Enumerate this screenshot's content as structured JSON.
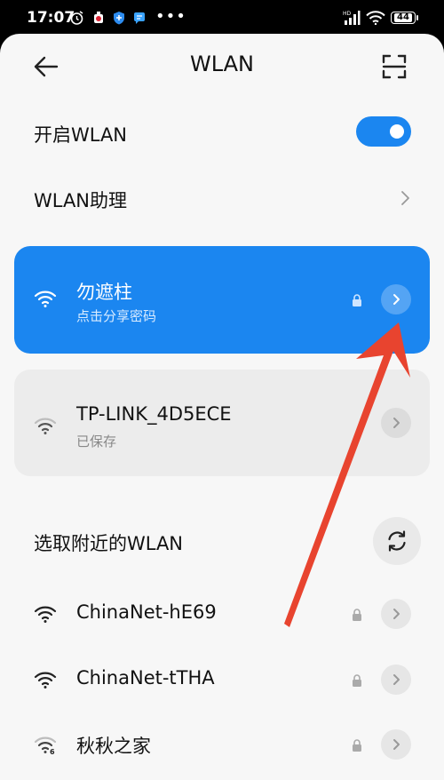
{
  "status_bar": {
    "time": "17:07",
    "more": "•••",
    "battery_level": "44",
    "icons": [
      "alarm-icon",
      "app-notification-icon",
      "shield-app-icon",
      "message-app-icon",
      "signal-icon",
      "wifi-icon",
      "battery-icon"
    ]
  },
  "header": {
    "title": "WLAN",
    "back_icon": "back-arrow-icon",
    "scan_icon": "scan-icon"
  },
  "settings": {
    "enable_wlan_label": "开启WLAN",
    "enable_wlan_on": true,
    "assistant_label": "WLAN助理"
  },
  "connected_network": {
    "name": "勿遮柱",
    "subtitle": "点击分享密码",
    "locked": true
  },
  "saved_network": {
    "name": "TP-LINK_4D5ECE",
    "subtitle": "已保存"
  },
  "nearby": {
    "section_title": "选取附近的WLAN",
    "refresh_icon": "refresh-icon",
    "networks": [
      {
        "name": "ChinaNet-hE69",
        "locked": true
      },
      {
        "name": "ChinaNet-tTHA",
        "locked": true
      },
      {
        "name": "秋秋之家",
        "locked": true,
        "wifi_badge": "6"
      }
    ]
  },
  "colors": {
    "accent": "#1b86f0",
    "annotation_arrow": "#e8442f",
    "background": "#f7f7f7",
    "card_gray": "#ececec"
  }
}
